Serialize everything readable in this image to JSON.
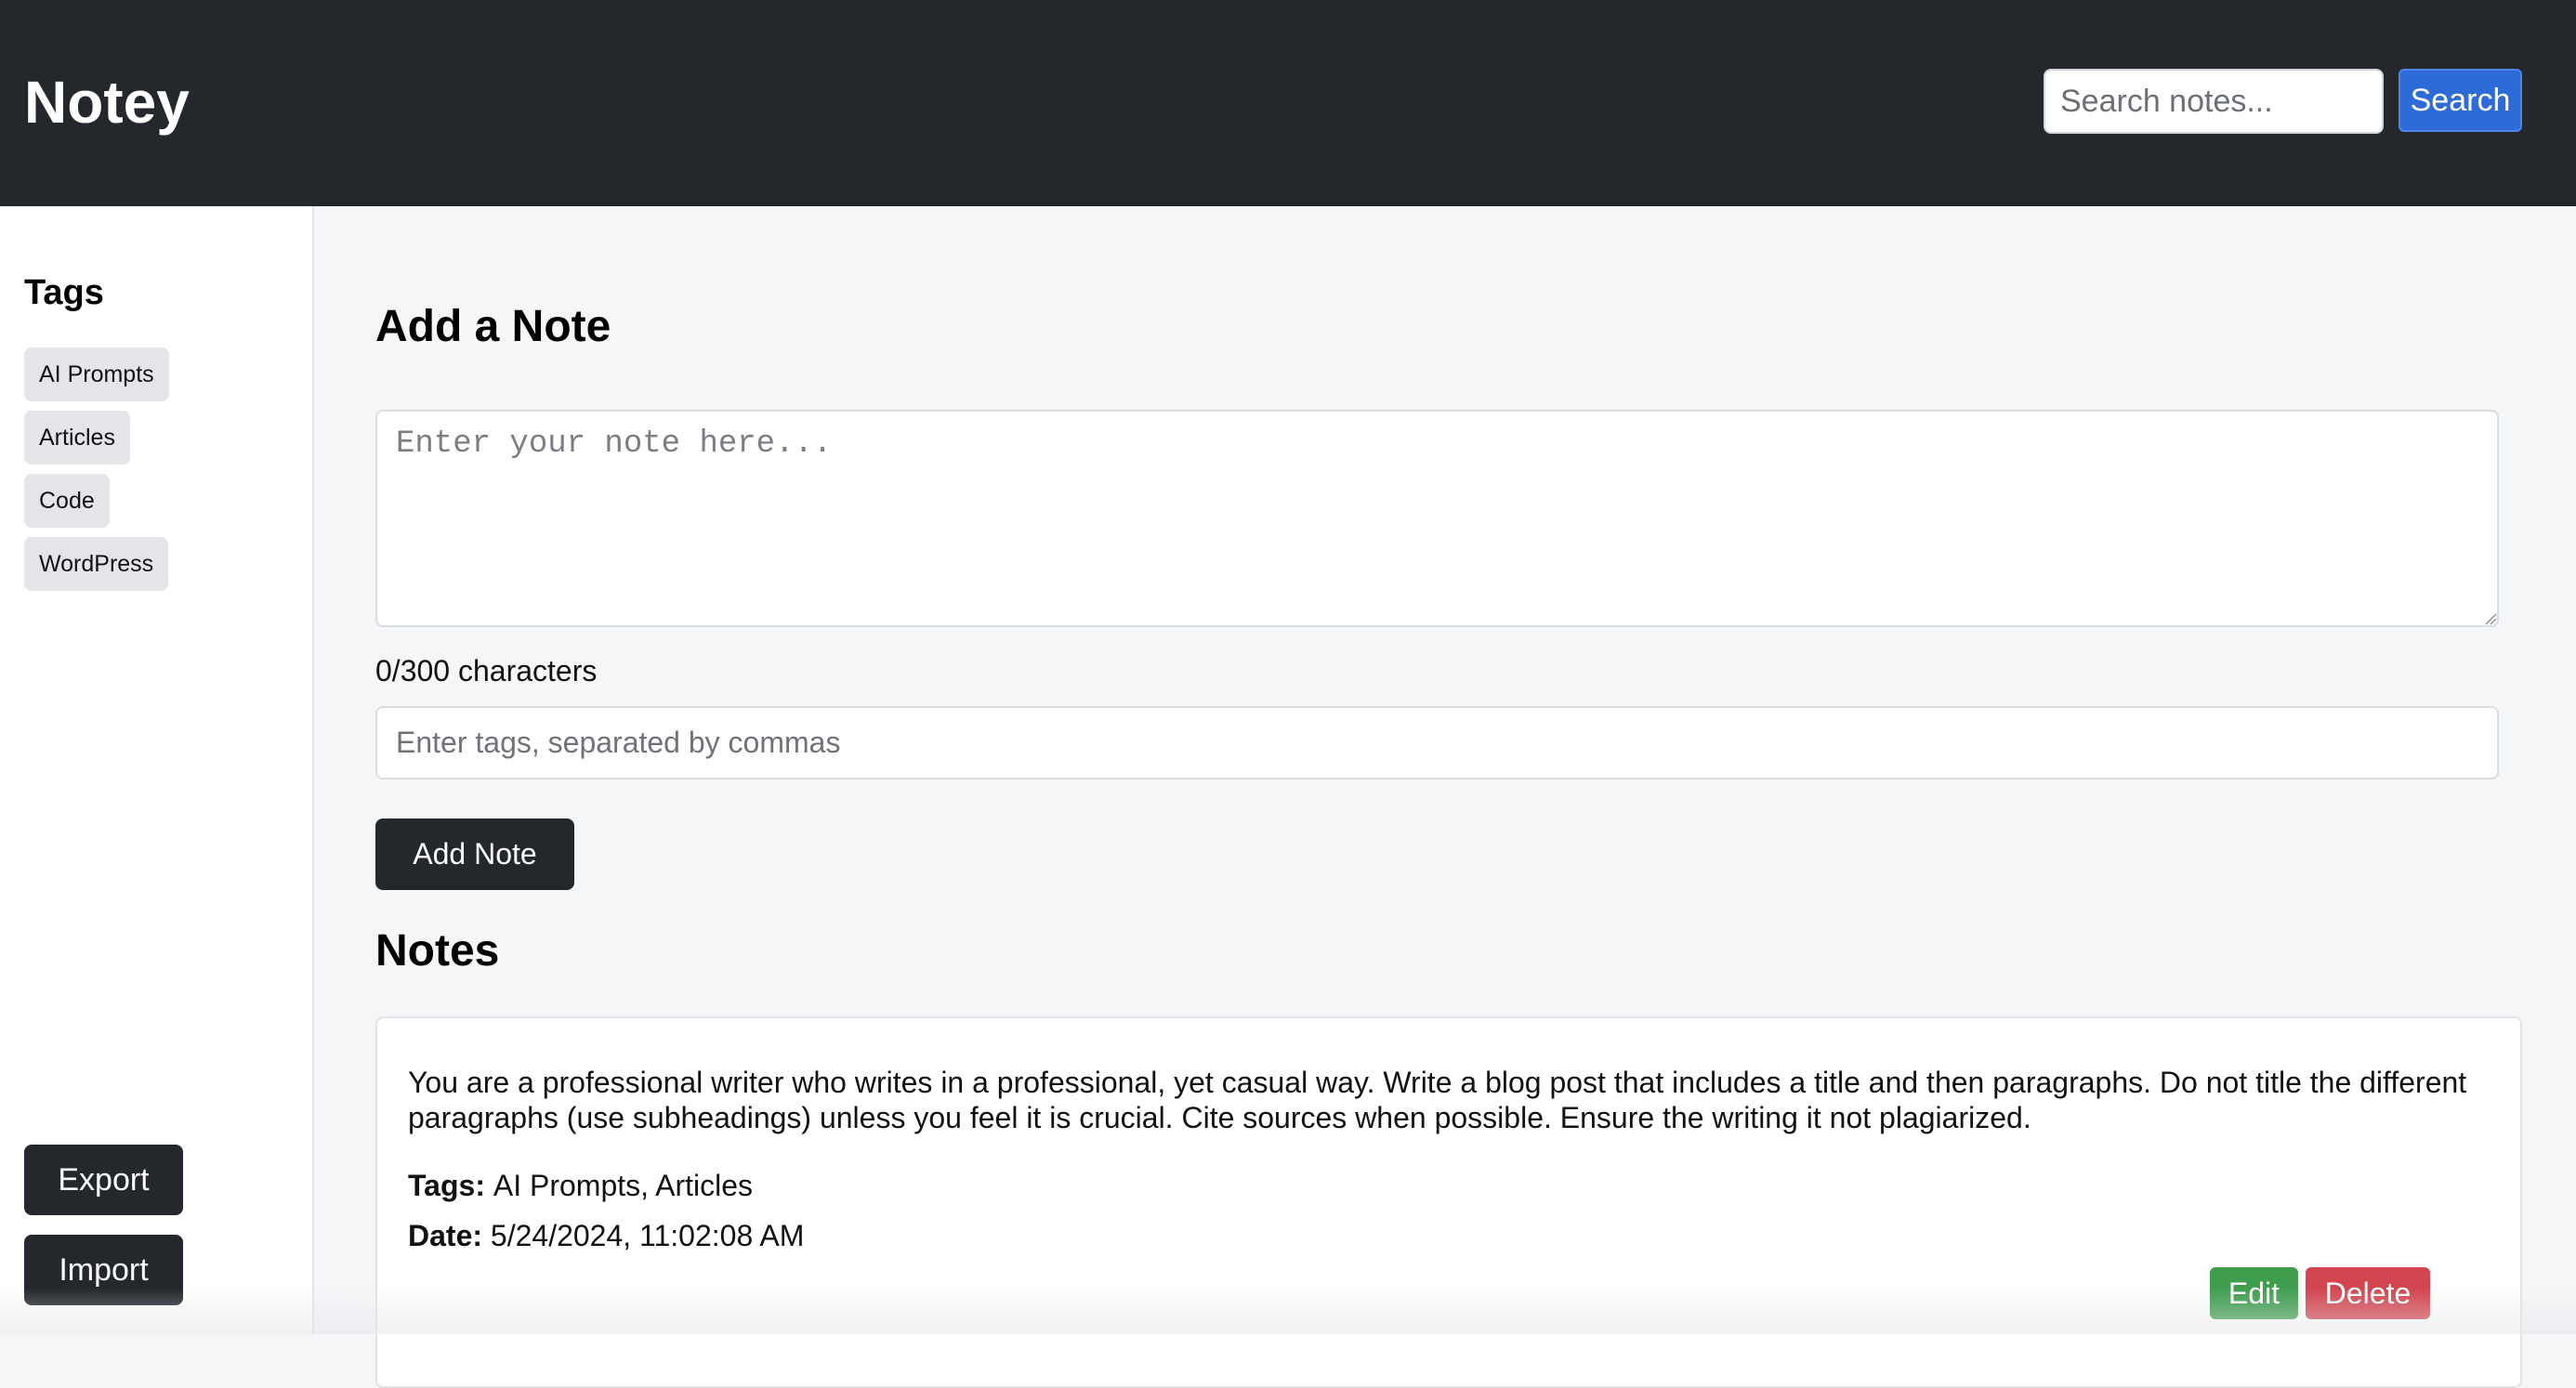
{
  "app": {
    "title": "Notey"
  },
  "header": {
    "search": {
      "placeholder": "Search notes...",
      "value": ""
    },
    "search_button_label": "Search"
  },
  "sidebar": {
    "title": "Tags",
    "tags": [
      "AI Prompts",
      "Articles",
      "Code",
      "WordPress"
    ],
    "export_label": "Export",
    "import_label": "Import"
  },
  "add_note": {
    "heading": "Add a Note",
    "note_placeholder": "Enter your note here...",
    "note_value": "",
    "char_count": "0/300 characters",
    "tags_placeholder": "Enter tags, separated by commas",
    "tags_value": "",
    "add_button_label": "Add Note"
  },
  "notes": {
    "heading": "Notes",
    "items": [
      {
        "text": "You are a professional writer who writes in a professional, yet casual way. Write a blog post that includes a title and then paragraphs. Do not title the different paragraphs (use subheadings) unless you feel it is crucial. Cite sources when possible. Ensure the writing it not plagiarized.",
        "tags_label": "Tags:",
        "tags": "AI Prompts, Articles",
        "date_label": "Date:",
        "date": "5/24/2024, 11:02:08 AM",
        "edit_label": "Edit",
        "delete_label": "Delete"
      }
    ]
  },
  "colors": {
    "header_bg": "#24272c",
    "primary_button": "#2d6bd8",
    "edit_button": "#3f9d4e",
    "delete_button": "#d3454f",
    "tag_chip_bg": "#e4e5e8"
  }
}
